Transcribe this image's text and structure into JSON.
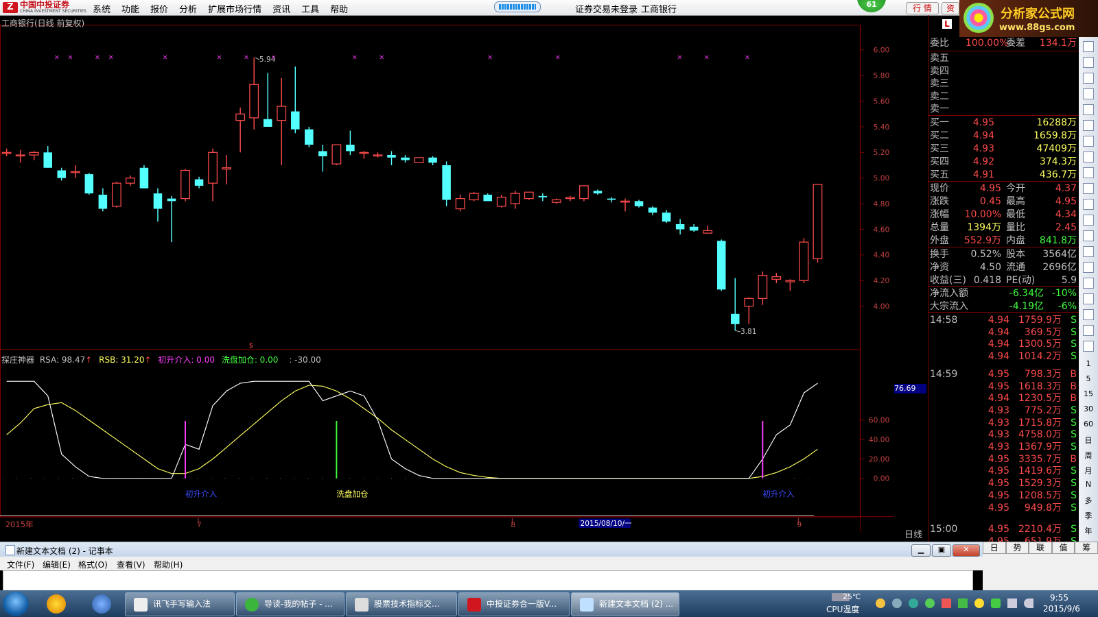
{
  "menubar": {
    "logo_text": "中国中投证券",
    "logo_sub": "CHINA INVESTMENT SECURITIES",
    "items": [
      "系统",
      "功能",
      "报价",
      "分析",
      "扩展市场行情",
      "资讯",
      "工具",
      "帮助"
    ],
    "status_login": "证券交易未登录",
    "stock_name": "工商银行",
    "badge": "61",
    "tab_quote": "行 情",
    "tab_trade": "资"
  },
  "site_logo": {
    "title": "分析家公式网",
    "url": "www.88gs.com"
  },
  "chart": {
    "stock_title": "工商银行(日线 前复权)",
    "price_axis": [
      "6.00",
      "5.80",
      "5.60",
      "5.40",
      "5.20",
      "5.00",
      "4.80",
      "4.60",
      "4.40",
      "4.20",
      "4.00"
    ],
    "high_label": "5.94",
    "low_label": "3.81",
    "bottom_dates": [
      "2015年",
      "7",
      "8",
      "2015/08/10/一",
      "9"
    ],
    "period_label": "日线",
    "indicator_title": "探庄神器",
    "rsa": "RSA: 98.47",
    "rsb": "RSB: 31.20",
    "csjr": "初升介入: 0.00",
    "xpjc": "洗盘加仓: 0.00",
    "neg": ": -30.00",
    "ind_axis": [
      "60.00",
      "40.00",
      "20.00",
      "0.00"
    ],
    "ind_current": "76.69",
    "ann_csjr": "初升介入",
    "ann_xpjc": "洗盘加仓",
    "colors": {
      "up": "#ff4b4b",
      "down": "#54ffff",
      "yellow": "#ffff60",
      "white": "#ffffff",
      "magenta": "#ff40ff",
      "green": "#40ff40"
    }
  },
  "chart_data": {
    "type": "candlestick",
    "y_range": [
      3.8,
      6.0
    ],
    "candles": [
      {
        "o": 5.2,
        "h": 5.23,
        "l": 5.17,
        "c": 5.2
      },
      {
        "o": 5.18,
        "h": 5.22,
        "l": 5.12,
        "c": 5.18
      },
      {
        "o": 5.18,
        "h": 5.21,
        "l": 5.14,
        "c": 5.2
      },
      {
        "o": 5.2,
        "h": 5.25,
        "l": 5.08,
        "c": 5.08
      },
      {
        "o": 5.06,
        "h": 5.08,
        "l": 4.98,
        "c": 5.0
      },
      {
        "o": 5.05,
        "h": 5.1,
        "l": 5.0,
        "c": 5.05
      },
      {
        "o": 5.03,
        "h": 5.04,
        "l": 4.87,
        "c": 4.88
      },
      {
        "o": 4.87,
        "h": 4.92,
        "l": 4.74,
        "c": 4.76
      },
      {
        "o": 4.78,
        "h": 4.97,
        "l": 4.77,
        "c": 4.96
      },
      {
        "o": 4.96,
        "h": 5.02,
        "l": 4.94,
        "c": 5.0
      },
      {
        "o": 5.08,
        "h": 5.1,
        "l": 4.92,
        "c": 4.92
      },
      {
        "o": 4.88,
        "h": 4.92,
        "l": 4.66,
        "c": 4.76
      },
      {
        "o": 4.84,
        "h": 4.86,
        "l": 4.5,
        "c": 4.82
      },
      {
        "o": 4.84,
        "h": 5.07,
        "l": 4.82,
        "c": 5.06
      },
      {
        "o": 4.99,
        "h": 5.01,
        "l": 4.92,
        "c": 4.94
      },
      {
        "o": 4.96,
        "h": 5.23,
        "l": 4.82,
        "c": 5.2
      },
      {
        "o": 5.07,
        "h": 5.18,
        "l": 4.95,
        "c": 5.08
      },
      {
        "o": 5.45,
        "h": 5.55,
        "l": 5.2,
        "c": 5.5
      },
      {
        "o": 5.47,
        "h": 5.94,
        "l": 5.38,
        "c": 5.73
      },
      {
        "o": 5.46,
        "h": 5.82,
        "l": 5.41,
        "c": 5.4
      },
      {
        "o": 5.45,
        "h": 5.78,
        "l": 5.1,
        "c": 5.56
      },
      {
        "o": 5.52,
        "h": 5.87,
        "l": 5.35,
        "c": 5.38
      },
      {
        "o": 5.38,
        "h": 5.4,
        "l": 5.24,
        "c": 5.26
      },
      {
        "o": 5.21,
        "h": 5.26,
        "l": 5.05,
        "c": 5.17
      },
      {
        "o": 5.11,
        "h": 5.26,
        "l": 5.1,
        "c": 5.26
      },
      {
        "o": 5.26,
        "h": 5.37,
        "l": 5.18,
        "c": 5.21
      },
      {
        "o": 5.2,
        "h": 5.21,
        "l": 5.15,
        "c": 5.2
      },
      {
        "o": 5.18,
        "h": 5.2,
        "l": 5.16,
        "c": 5.18
      },
      {
        "o": 5.18,
        "h": 5.21,
        "l": 5.1,
        "c": 5.16
      },
      {
        "o": 5.16,
        "h": 5.18,
        "l": 5.12,
        "c": 5.14
      },
      {
        "o": 5.12,
        "h": 5.16,
        "l": 5.12,
        "c": 5.16
      },
      {
        "o": 5.16,
        "h": 5.17,
        "l": 5.1,
        "c": 5.12
      },
      {
        "o": 5.1,
        "h": 5.13,
        "l": 4.78,
        "c": 4.83
      },
      {
        "o": 4.76,
        "h": 4.87,
        "l": 4.74,
        "c": 4.84
      },
      {
        "o": 4.83,
        "h": 4.89,
        "l": 4.82,
        "c": 4.88
      },
      {
        "o": 4.87,
        "h": 4.88,
        "l": 4.82,
        "c": 4.82
      },
      {
        "o": 4.78,
        "h": 4.87,
        "l": 4.77,
        "c": 4.85
      },
      {
        "o": 4.8,
        "h": 4.9,
        "l": 4.76,
        "c": 4.88
      },
      {
        "o": 4.84,
        "h": 4.89,
        "l": 4.83,
        "c": 4.89
      },
      {
        "o": 4.86,
        "h": 4.88,
        "l": 4.82,
        "c": 4.85
      },
      {
        "o": 4.81,
        "h": 4.84,
        "l": 4.8,
        "c": 4.83
      },
      {
        "o": 4.84,
        "h": 4.86,
        "l": 4.82,
        "c": 4.85
      },
      {
        "o": 4.84,
        "h": 4.94,
        "l": 4.82,
        "c": 4.94
      },
      {
        "o": 4.9,
        "h": 4.91,
        "l": 4.87,
        "c": 4.88
      },
      {
        "o": 4.84,
        "h": 4.85,
        "l": 4.81,
        "c": 4.83
      },
      {
        "o": 4.82,
        "h": 4.84,
        "l": 4.74,
        "c": 4.82
      },
      {
        "o": 4.82,
        "h": 4.83,
        "l": 4.77,
        "c": 4.78
      },
      {
        "o": 4.77,
        "h": 4.78,
        "l": 4.71,
        "c": 4.73
      },
      {
        "o": 4.73,
        "h": 4.75,
        "l": 4.65,
        "c": 4.66
      },
      {
        "o": 4.64,
        "h": 4.68,
        "l": 4.56,
        "c": 4.6
      },
      {
        "o": 4.62,
        "h": 4.64,
        "l": 4.58,
        "c": 4.59
      },
      {
        "o": 4.57,
        "h": 4.63,
        "l": 4.57,
        "c": 4.59
      },
      {
        "o": 4.51,
        "h": 4.52,
        "l": 4.12,
        "c": 4.13
      },
      {
        "o": 3.94,
        "h": 4.22,
        "l": 3.81,
        "c": 3.86
      },
      {
        "o": 4.0,
        "h": 4.07,
        "l": 3.86,
        "c": 4.06
      },
      {
        "o": 4.06,
        "h": 4.27,
        "l": 4.01,
        "c": 4.24
      },
      {
        "o": 4.21,
        "h": 4.26,
        "l": 4.18,
        "c": 4.23
      },
      {
        "o": 4.19,
        "h": 4.21,
        "l": 4.12,
        "c": 4.2
      },
      {
        "o": 4.2,
        "h": 4.53,
        "l": 4.18,
        "c": 4.5
      },
      {
        "o": 4.37,
        "h": 4.95,
        "l": 4.34,
        "c": 4.95
      }
    ],
    "indicator": {
      "y_range": [
        0,
        100
      ],
      "white_line": [
        100,
        100,
        100,
        85,
        25,
        12,
        2,
        0,
        0,
        0,
        0,
        0,
        0,
        35,
        30,
        75,
        90,
        98,
        100,
        100,
        100,
        100,
        100,
        80,
        85,
        90,
        85,
        60,
        20,
        10,
        3,
        0,
        0,
        0,
        0,
        0,
        0,
        0,
        0,
        0,
        0,
        0,
        0,
        0,
        0,
        0,
        0,
        0,
        0,
        0,
        0,
        0,
        0,
        0,
        0,
        20,
        45,
        55,
        88,
        98
      ],
      "yellow_line": [
        45,
        57,
        72,
        76,
        78,
        70,
        60,
        50,
        40,
        30,
        20,
        10,
        5,
        5,
        10,
        20,
        32,
        44,
        56,
        68,
        80,
        90,
        96,
        95,
        90,
        82,
        72,
        62,
        50,
        40,
        30,
        20,
        12,
        6,
        3,
        1,
        0,
        0,
        0,
        0,
        0,
        0,
        0,
        0,
        0,
        0,
        0,
        0,
        0,
        0,
        0,
        0,
        0,
        0,
        0,
        2,
        6,
        12,
        20,
        30
      ],
      "markers": [
        {
          "index": 13,
          "type": "初升介入"
        },
        {
          "index": 24,
          "type": "洗盘加仓"
        },
        {
          "index": 55,
          "type": "初升介入"
        }
      ]
    }
  },
  "quote": {
    "code_icon": "L",
    "wb": {
      "k": "委比",
      "v": "100.00%",
      "k2": "委差",
      "v2": "134.1万"
    },
    "sell": [
      "卖五",
      "卖四",
      "卖三",
      "卖二",
      "卖一"
    ],
    "buy": [
      {
        "k": "买一",
        "p": "4.95",
        "v": "16288万"
      },
      {
        "k": "买二",
        "p": "4.94",
        "v": "1659.8万"
      },
      {
        "k": "买三",
        "p": "4.93",
        "v": "47409万"
      },
      {
        "k": "买四",
        "p": "4.92",
        "v": "374.3万"
      },
      {
        "k": "买五",
        "p": "4.91",
        "v": "436.7万"
      }
    ],
    "stats": [
      {
        "k": "现价",
        "v": "4.95",
        "k2": "今开",
        "v2": "4.37"
      },
      {
        "k": "涨跌",
        "v": "0.45",
        "k2": "最高",
        "v2": "4.95"
      },
      {
        "k": "涨幅",
        "v": "10.00%",
        "k2": "最低",
        "v2": "4.34"
      },
      {
        "k": "总量",
        "v": "1394万",
        "k2": "量比",
        "v2": "2.45"
      },
      {
        "k": "外盘",
        "v": "552.9万",
        "k2": "内盘",
        "v2": "841.8万"
      }
    ],
    "fin": [
      {
        "k": "换手",
        "v": "0.52%",
        "k2": "股本",
        "v2": "3564亿"
      },
      {
        "k": "净资",
        "v": "4.50",
        "k2": "流通",
        "v2": "2696亿"
      },
      {
        "k": "收益(三)",
        "v": "0.418",
        "k2": "PE(动)",
        "v2": "5.9"
      }
    ],
    "flows": [
      {
        "k": "净流入额",
        "v": "-6.34亿",
        "p": "-10%"
      },
      {
        "k": "大宗流入",
        "v": "-4.19亿",
        "p": "-6%"
      }
    ],
    "ticks": [
      {
        "t": "14:58",
        "p": "4.94",
        "v": "1759.9万",
        "s": "S"
      },
      {
        "t": "",
        "p": "4.94",
        "v": "369.5万",
        "s": "S"
      },
      {
        "t": "",
        "p": "4.94",
        "v": "1300.5万",
        "s": "S"
      },
      {
        "t": "",
        "p": "4.94",
        "v": "1014.2万",
        "s": "S"
      },
      {
        "t": "14:59",
        "p": "4.95",
        "v": "798.3万",
        "s": "B"
      },
      {
        "t": "",
        "p": "4.95",
        "v": "1618.3万",
        "s": "B"
      },
      {
        "t": "",
        "p": "4.94",
        "v": "1230.5万",
        "s": "B"
      },
      {
        "t": "",
        "p": "4.93",
        "v": "775.2万",
        "s": "S"
      },
      {
        "t": "",
        "p": "4.93",
        "v": "1715.8万",
        "s": "S"
      },
      {
        "t": "",
        "p": "4.93",
        "v": "4758.0万",
        "s": "S"
      },
      {
        "t": "",
        "p": "4.93",
        "v": "1367.9万",
        "s": "S"
      },
      {
        "t": "",
        "p": "4.95",
        "v": "3335.7万",
        "s": "B"
      },
      {
        "t": "",
        "p": "4.95",
        "v": "1419.6万",
        "s": "S"
      },
      {
        "t": "",
        "p": "4.95",
        "v": "1529.3万",
        "s": "S"
      },
      {
        "t": "",
        "p": "4.95",
        "v": "1208.5万",
        "s": "S"
      },
      {
        "t": "",
        "p": "4.95",
        "v": "949.8万",
        "s": "S"
      },
      {
        "t": "15:00",
        "p": "4.95",
        "v": "2210.4万",
        "s": "S"
      },
      {
        "t": "",
        "p": "4.95",
        "v": "651.9万",
        "s": "S"
      }
    ],
    "side_tabs": [
      "日",
      "势",
      "联",
      "值",
      "筹"
    ],
    "toolstrip_labels": [
      "1",
      "5",
      "15",
      "30",
      "60",
      "日",
      "周",
      "月",
      "N",
      "多",
      "季",
      "年"
    ]
  },
  "notepad": {
    "title": "新建文本文档 (2) - 记事本",
    "menu": [
      "文件(F)",
      "编辑(E)",
      "格式(O)",
      "查看(V)",
      "帮助(H)"
    ]
  },
  "taskbar": {
    "apps": [
      "讯飞手写输入法",
      "导读-我的帖子 - ...",
      "股票技术指标交...",
      "中投证券合一版V...",
      "新建文本文档 (2) ..."
    ],
    "temp": "25℃",
    "temp_label": "CPU温度",
    "time": "9:55",
    "date": "2015/9/6"
  }
}
